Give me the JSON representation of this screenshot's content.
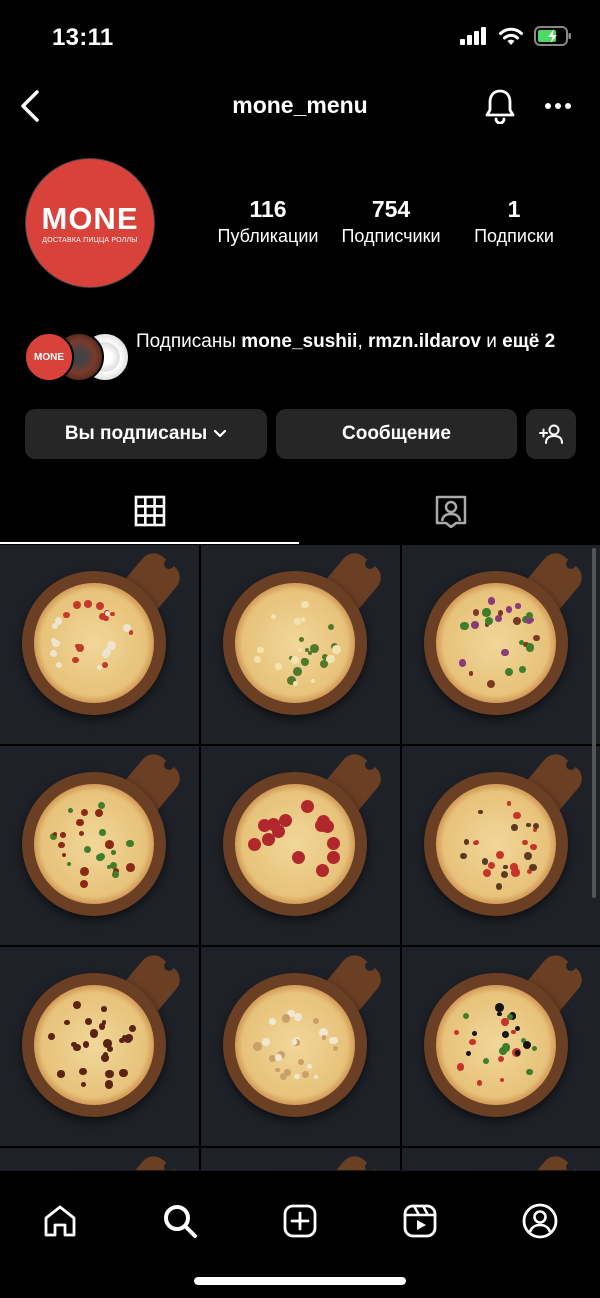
{
  "status_bar": {
    "time": "13:11"
  },
  "header": {
    "title": "mone_menu"
  },
  "profile": {
    "avatar_brand": "MONE",
    "avatar_tagline": "ДОСТАВКА ПИЦЦА РОЛЛЫ",
    "stats": [
      {
        "value": "116",
        "label": "Публикации"
      },
      {
        "value": "754",
        "label": "Подписчики"
      },
      {
        "value": "1",
        "label": "Подписки"
      }
    ],
    "followed_by": {
      "prefix": "Подписаны ",
      "user1": "mone_sushii",
      "sep": ", ",
      "user2": "rmzn.ildarov",
      "suffix": " и ",
      "more": "ещё 2"
    }
  },
  "actions": {
    "following_label": "Вы подписаны",
    "message_label": "Сообщение"
  },
  "tabs": [
    {
      "icon": "grid-icon"
    },
    {
      "icon": "tagged-icon"
    }
  ],
  "posts": [
    {
      "pizza": "mushroom"
    },
    {
      "pizza": "herb"
    },
    {
      "pizza": "onion"
    },
    {
      "pizza": "sauce"
    },
    {
      "pizza": "pepperoni"
    },
    {
      "pizza": "tomato"
    },
    {
      "pizza": "salami"
    },
    {
      "pizza": "chicken-mushroom"
    },
    {
      "pizza": "olive-pepper"
    },
    {
      "pizza": "partial"
    },
    {
      "pizza": "partial"
    },
    {
      "pizza": "partial"
    }
  ],
  "bottom_nav": [
    {
      "icon": "home-icon"
    },
    {
      "icon": "search-icon"
    },
    {
      "icon": "add-post-icon"
    },
    {
      "icon": "reels-icon"
    },
    {
      "icon": "profile-icon"
    }
  ],
  "colors": {
    "brand_red": "#d8423a",
    "button_bg": "#262626"
  }
}
